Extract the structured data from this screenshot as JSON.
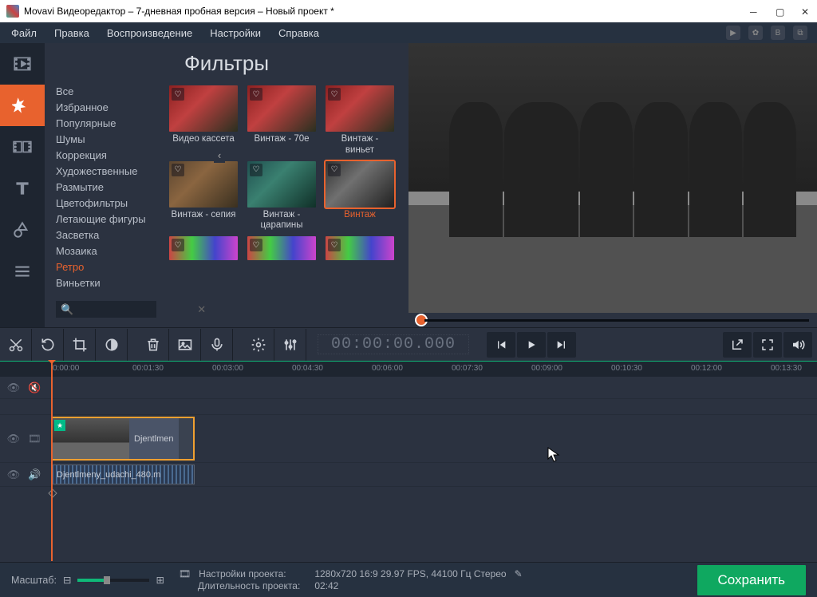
{
  "titlebar": {
    "text": "Movavi Видеоредактор – 7-дневная пробная версия – Новый проект *"
  },
  "menu": {
    "file": "Файл",
    "edit": "Правка",
    "playback": "Воспроизведение",
    "settings": "Настройки",
    "help": "Справка"
  },
  "filters": {
    "title": "Фильтры",
    "cats": [
      "Все",
      "Избранное",
      "Популярные",
      "Шумы",
      "Коррекция",
      "Художественные",
      "Размытие",
      "Цветофильтры",
      "Летающие фигуры",
      "Засветка",
      "Мозаика",
      "Ретро",
      "Виньетки"
    ],
    "active_cat": "Ретро",
    "items": [
      {
        "label": "Видео кассета"
      },
      {
        "label": "Винтаж - 70е"
      },
      {
        "label": "Винтаж - виньет"
      },
      {
        "label": "Винтаж - сепия"
      },
      {
        "label": "Винтаж - царапины"
      },
      {
        "label": "Винтаж"
      }
    ],
    "selected_item": 5
  },
  "timecode": "00:00:00.000",
  "ruler": [
    "0:00:00",
    "00:01:30",
    "00:03:00",
    "00:04:30",
    "00:06:00",
    "00:07:30",
    "00:09:00",
    "00:10:30",
    "00:12:00",
    "00:13:30"
  ],
  "clips": {
    "video": "Djentlmen",
    "audio": "Djentlmeny_udachi_480.m"
  },
  "status": {
    "zoom_label": "Масштаб:",
    "proj_settings_label": "Настройки проекта:",
    "proj_settings_value": "1280x720 16:9 29.97 FPS, 44100 Гц Стерео",
    "duration_label": "Длительность проекта:",
    "duration_value": "02:42",
    "save": "Сохранить"
  }
}
